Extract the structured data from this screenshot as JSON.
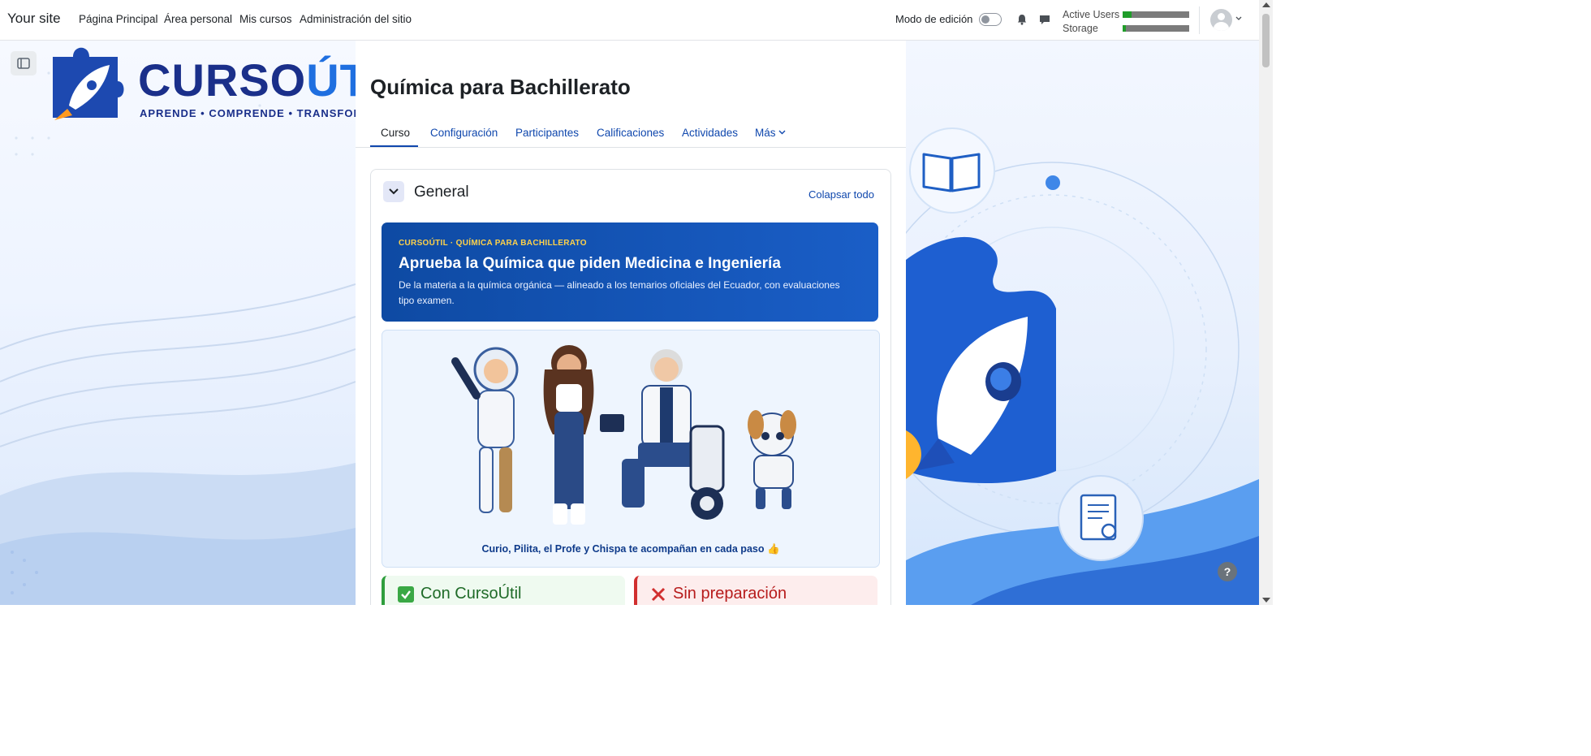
{
  "navbar": {
    "brand": "Your site",
    "links": [
      "Página Principal",
      "Área personal",
      "Mis cursos",
      "Administración del sitio"
    ],
    "edit_mode_label": "Modo de edición",
    "usage": [
      {
        "label": "Active Users",
        "fill_fraction": 0.13
      },
      {
        "label": "Storage",
        "fill_fraction": 0.05
      }
    ],
    "icons": [
      "bell-icon",
      "chat-icon",
      "avatar-icon",
      "chevron-down-icon"
    ]
  },
  "logo": {
    "text_main": "CURSO",
    "text_accent": "ÚTIL",
    "tagline": "APRENDE • COMPRENDE • TRANSFORMA"
  },
  "course": {
    "title": "Química para Bachillerato",
    "tabs": [
      "Curso",
      "Configuración",
      "Participantes",
      "Calificaciones",
      "Actividades",
      "Más"
    ],
    "active_tab": "Curso"
  },
  "section": {
    "title": "General",
    "collapse_all": "Colapsar todo",
    "hero": {
      "kicker": "CURSOÚTIL · QUÍMICA PARA BACHILLERATO",
      "title": "Aprueba la Química que piden Medicina e Ingeniería",
      "subtitle": "De la materia a la química orgánica — alineado a los temarios oficiales del Ecuador, con evaluaciones tipo examen."
    },
    "mascots_caption": "Curio, Pilita, el Profe y Chispa te acompañan en cada paso 👍",
    "compare": {
      "good": "Con CursoÚtil",
      "bad": "Sin preparación"
    }
  },
  "help_label": "?",
  "colors": {
    "link": "#0f47ad",
    "hero_bg": "#0e4aa3",
    "hero_kicker": "#ffd24a",
    "good": "#2e9e3c",
    "bad": "#d12f2f"
  }
}
